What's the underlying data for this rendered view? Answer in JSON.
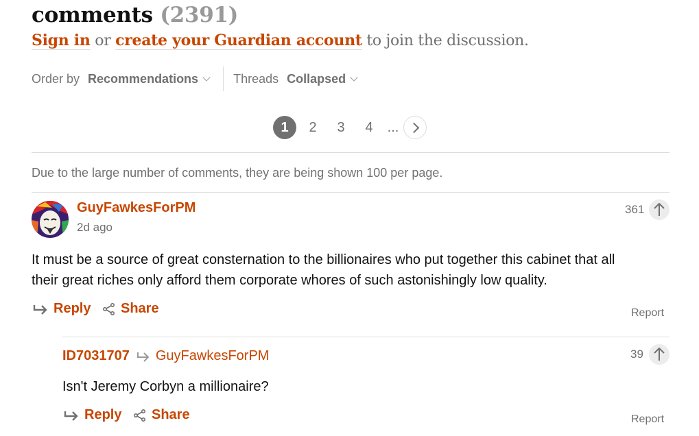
{
  "header": {
    "title": "comments",
    "count": "(2391)",
    "sign_in": "Sign in",
    "or": "or",
    "create_account": "create your Guardian account",
    "join_text": "to join the discussion."
  },
  "controls": {
    "order_label": "Order by",
    "order_value": "Recommendations",
    "threads_label": "Threads",
    "threads_value": "Collapsed"
  },
  "pagination": {
    "pages": [
      "1",
      "2",
      "3",
      "4"
    ],
    "current": "1",
    "ellipsis": "..."
  },
  "notice": "Due to the large number of comments, they are being shown 100 per page.",
  "comments": [
    {
      "username": "GuyFawkesForPM",
      "timestamp": "2d ago",
      "recommend_count": "361",
      "body_lines": [
        "It must be a source of great consternation to the billionaires who put together this cabinet that all",
        "their great riches only afford them corporate whores of such astonishingly low quality."
      ],
      "reply_label": "Reply",
      "share_label": "Share",
      "report_label": "Report"
    },
    {
      "username": "ID7031707",
      "reply_to": "GuyFawkesForPM",
      "recommend_count": "39",
      "body": "Isn't Jeremy Corbyn a millionaire?",
      "reply_label": "Reply",
      "share_label": "Share",
      "report_label": "Report"
    }
  ],
  "colors": {
    "accent": "#c74600",
    "muted": "#707070",
    "border": "#dcdcdc"
  }
}
